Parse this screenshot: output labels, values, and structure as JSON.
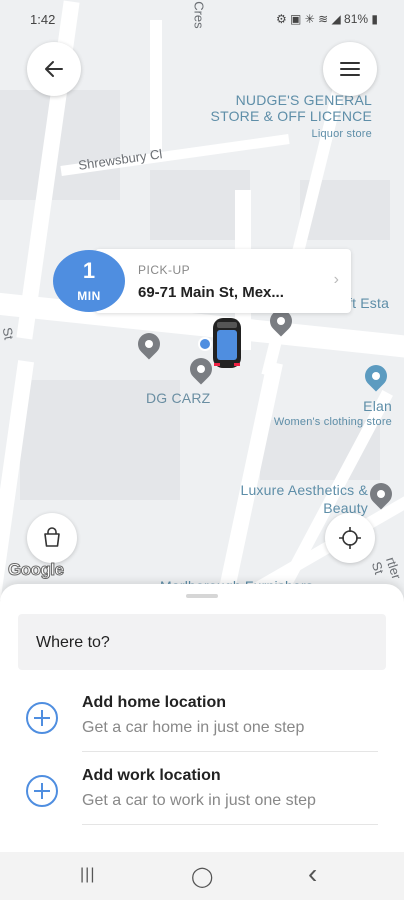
{
  "status_bar": {
    "time": "1:42",
    "icons": "⚙ ▣ ✳ ≋ ◢ 81% ▮"
  },
  "map": {
    "labels": {
      "store_name": "NUDGE'S GENERAL STORE & OFF LICENCE",
      "store_type": "Liquor store",
      "street_shrewsbury": "Shrewsbury Cl",
      "dg_carz": "DG CARZ",
      "elan": "Elan",
      "elan_type": "Women's clothing store",
      "luxure": "Luxure Aesthetics & Beauty",
      "loft_partial": "oft Esta",
      "street_top": "n Cres",
      "street_left": "St",
      "bottom_partial": "Marlborough Furnishers",
      "right_street": "rtler St"
    },
    "google_logo": "Google"
  },
  "buttons": {
    "back_icon": "back-arrow-icon",
    "menu_icon": "hamburger-menu-icon",
    "bag_icon": "bag-icon",
    "locate_icon": "crosshair-icon"
  },
  "eta": {
    "number": "1",
    "unit": "MIN"
  },
  "pickup": {
    "label": "PICK-UP",
    "address": "69-71 Main St, Mex...",
    "chevron": "›"
  },
  "sheet": {
    "where_to": "Where to?",
    "options": [
      {
        "title": "Add home location",
        "subtitle": "Get a car home in just one step"
      },
      {
        "title": "Add work location",
        "subtitle": "Get a car to work in just one step"
      }
    ]
  },
  "nav": {
    "recents": "|||",
    "home": "◯",
    "back": "‹"
  },
  "colors": {
    "accent": "#4f8ee0",
    "map_label": "#5e8ea8"
  }
}
